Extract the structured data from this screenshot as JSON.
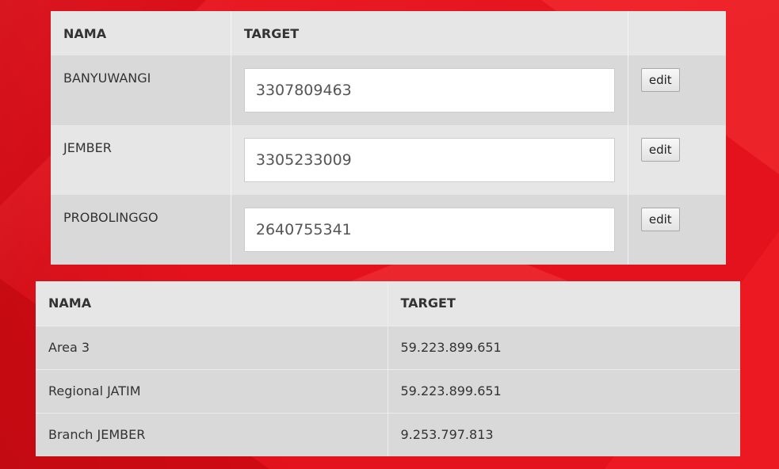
{
  "target_table": {
    "headers": {
      "nama": "NAMA",
      "target": "TARGET",
      "action": ""
    },
    "rows": [
      {
        "nama": "BANYUWANGI",
        "target": "3307809463",
        "edit_label": "edit"
      },
      {
        "nama": "JEMBER",
        "target": "3305233009",
        "edit_label": "edit"
      },
      {
        "nama": "PROBOLINGGO",
        "target": "2640755341",
        "edit_label": "edit"
      }
    ]
  },
  "summary_table": {
    "headers": {
      "nama": "NAMA",
      "target": "TARGET"
    },
    "rows": [
      {
        "nama": "Area 3",
        "target": "59.223.899.651"
      },
      {
        "nama": "Regional JATIM",
        "target": "59.223.899.651"
      },
      {
        "nama": "Branch JEMBER",
        "target": "9.253.797.813"
      }
    ]
  },
  "colors": {
    "background": "#e4121c",
    "header_row": "#e6e6e6",
    "body_row_dark": "#d9d9d9"
  }
}
